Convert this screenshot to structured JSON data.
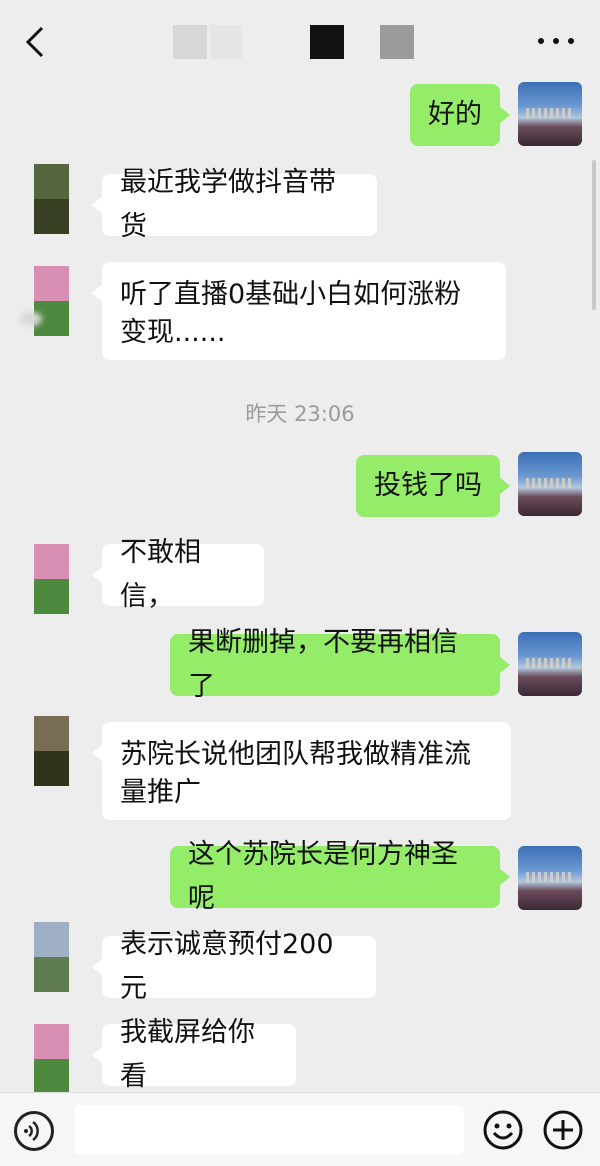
{
  "header": {
    "back_icon": "chevron-left-icon",
    "more_icon": "more-horizontal-icon"
  },
  "colors": {
    "background": "#ededed",
    "outgoing_bubble": "#95ec69",
    "incoming_bubble": "#ffffff",
    "timestamp_text": "#9a9a9a"
  },
  "messages": [
    {
      "side": "out",
      "text": "好的"
    },
    {
      "side": "in",
      "text": "最近我学做抖音带货"
    },
    {
      "side": "in",
      "text": "听了直播0基础小白如何涨粉变现......"
    },
    {
      "side": "out",
      "text": "投钱了吗"
    },
    {
      "side": "in",
      "text": "不敢相信，"
    },
    {
      "side": "out",
      "text": "果断删掉，不要再相信了"
    },
    {
      "side": "in",
      "text": "苏院长说他团队帮我做精准流量推广"
    },
    {
      "side": "out",
      "text": "这个苏院长是何方神圣呢"
    },
    {
      "side": "in",
      "text": "表示诚意预付200元"
    },
    {
      "side": "in",
      "text": "我截屏给你看"
    }
  ],
  "timestamp": "昨天 23:06",
  "input_bar": {
    "voice_icon": "voice-icon",
    "emoji_icon": "emoji-icon",
    "plus_icon": "plus-icon",
    "text_value": ""
  }
}
